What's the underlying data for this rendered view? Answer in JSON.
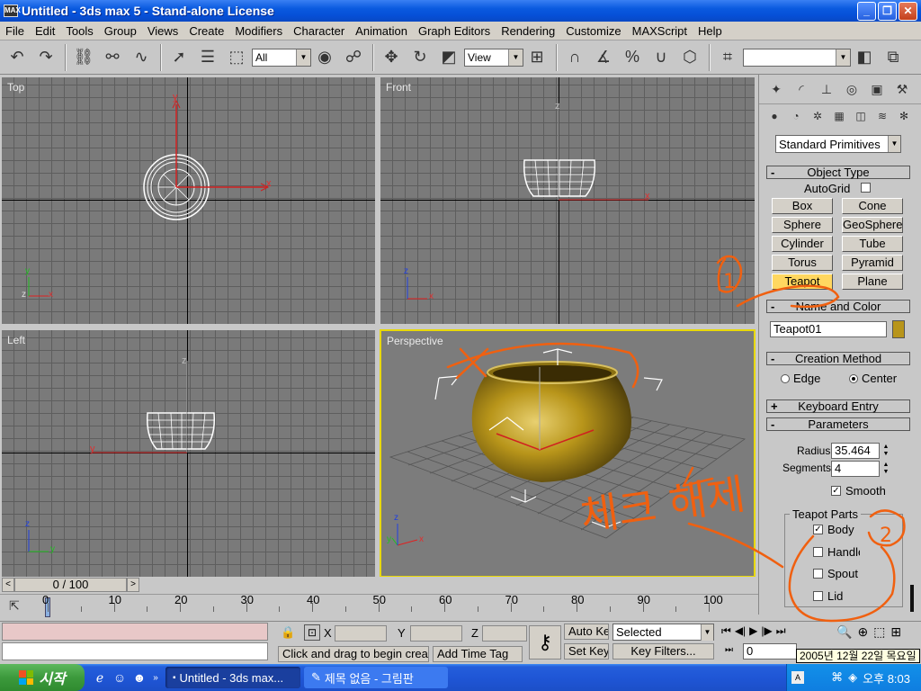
{
  "window": {
    "title": "Untitled - 3ds max 5 - Stand-alone License",
    "app_icon": "MAX"
  },
  "menu": [
    "File",
    "Edit",
    "Tools",
    "Group",
    "Views",
    "Create",
    "Modifiers",
    "Character",
    "Animation",
    "Graph Editors",
    "Rendering",
    "Customize",
    "MAXScript",
    "Help"
  ],
  "toolbar": {
    "selection_filter": "All",
    "ref_coord": "View",
    "named_selection": ""
  },
  "viewports": {
    "top": "Top",
    "front": "Front",
    "left": "Left",
    "perspective": "Perspective"
  },
  "axis_labels": {
    "x": "x",
    "y": "y",
    "z": "z"
  },
  "command_panel": {
    "category": "Standard Primitives",
    "object_type": {
      "header": "Object Type",
      "autogrid": "AutoGrid",
      "buttons": [
        "Box",
        "Cone",
        "Sphere",
        "GeoSphere",
        "Cylinder",
        "Tube",
        "Torus",
        "Pyramid",
        "Teapot",
        "Plane"
      ],
      "active": "Teapot"
    },
    "name_and_color": {
      "header": "Name and Color",
      "name": "Teapot01",
      "color": "#b8951a"
    },
    "creation_method": {
      "header": "Creation Method",
      "edge": "Edge",
      "center": "Center",
      "selected": "Center"
    },
    "keyboard_entry": {
      "header": "Keyboard Entry"
    },
    "parameters": {
      "header": "Parameters",
      "radius_label": "Radius:",
      "radius": "35.464",
      "segments_label": "Segments:",
      "segments": "4",
      "smooth": "Smooth",
      "smooth_checked": true,
      "parts_header": "Teapot Parts",
      "parts": [
        {
          "name": "Body",
          "checked": true
        },
        {
          "name": "Handle",
          "checked": false
        },
        {
          "name": "Spout",
          "checked": false
        },
        {
          "name": "Lid",
          "checked": false
        }
      ]
    }
  },
  "timeline": {
    "frame": "0 / 100",
    "ticks": [
      "0",
      "10",
      "20",
      "30",
      "40",
      "50",
      "60",
      "70",
      "80",
      "90",
      "100"
    ]
  },
  "status": {
    "prompt": "Click and drag to begin creation process",
    "add_time_tag": "Add Time Tag",
    "x_label": "X",
    "y_label": "Y",
    "z_label": "Z",
    "auto_key": "Auto Key",
    "set_key": "Set Key",
    "key_mode": "Selected",
    "key_filters": "Key Filters...",
    "current_frame": "0"
  },
  "annotations": {
    "mark1": "1",
    "mark2": "2",
    "note": "체크 해제"
  },
  "taskbar": {
    "start": "시작",
    "tasks": [
      "Untitled - 3ds max...",
      "제목 없음 - 그림판"
    ],
    "clock": "오후 8:03",
    "tooltip": "2005년 12월 22일 목요일"
  }
}
